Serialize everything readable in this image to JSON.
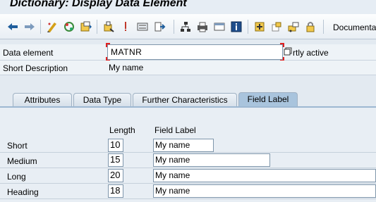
{
  "window": {
    "title": "Dictionary: Display Data Element"
  },
  "toolbar": {
    "buttons": [
      {
        "name": "back-arrow-icon"
      },
      {
        "name": "forward-arrow-icon"
      },
      {
        "name": "display-change-icon"
      },
      {
        "name": "activate-icon"
      },
      {
        "name": "other-object-icon"
      },
      {
        "name": "where-used-icon"
      },
      {
        "name": "check-icon"
      },
      {
        "name": "display-object-list-icon"
      },
      {
        "name": "navigation-icon"
      },
      {
        "name": "hierarchy-icon"
      },
      {
        "name": "print-icon"
      },
      {
        "name": "window-icon"
      },
      {
        "name": "info-icon"
      },
      {
        "name": "expand-icon"
      },
      {
        "name": "collapse-icon"
      },
      {
        "name": "transport-icon"
      },
      {
        "name": "lock-icon"
      }
    ],
    "documentation_label": "Documenta"
  },
  "header": {
    "data_element_label": "Data element",
    "data_element_value": "MATNR",
    "status_text": "rtly active",
    "short_desc_label": "Short Description",
    "short_desc_value": "My name"
  },
  "tabs": [
    {
      "label": "Attributes",
      "active": false
    },
    {
      "label": "Data Type",
      "active": false
    },
    {
      "label": "Further Characteristics",
      "active": false
    },
    {
      "label": "Field Label",
      "active": true
    }
  ],
  "field_label": {
    "col_length": "Length",
    "col_label": "Field Label",
    "rows": [
      {
        "label": "Short",
        "length": "10",
        "text": "My name"
      },
      {
        "label": "Medium",
        "length": "15",
        "text": "My name"
      },
      {
        "label": "Long",
        "length": "20",
        "text": "My name"
      },
      {
        "label": "Heading",
        "length": "18",
        "text": "My name"
      }
    ]
  },
  "colors": {
    "accent": "#a9c4dd",
    "toolbar_bg": "#e8eef4",
    "required_marker": "#e02020"
  }
}
